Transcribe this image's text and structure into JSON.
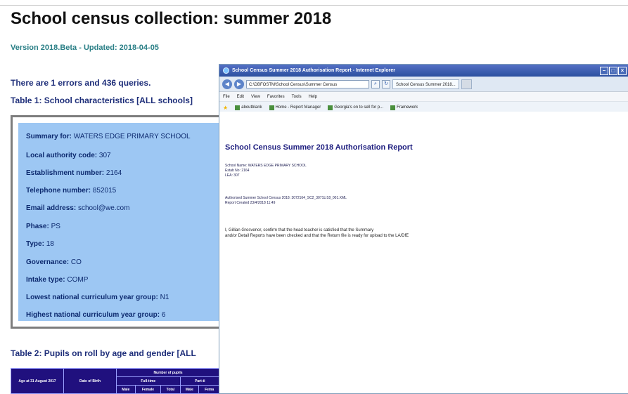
{
  "page": {
    "title": "School census collection: summer 2018",
    "version": "Version 2018.Beta - Updated: 2018-04-05",
    "errors_text": "There are 1 errors and 436 queries.",
    "table1_heading": "Table 1: School characteristics [ALL schools]",
    "table2_heading": "Table 2: Pupils on roll by age and gender [ALL"
  },
  "summary": [
    {
      "label": "Summary for:",
      "value": "WATERS EDGE PRIMARY SCHOOL"
    },
    {
      "label": "Local authority code:",
      "value": "307"
    },
    {
      "label": "Establishment number:",
      "value": "2164"
    },
    {
      "label": "Telephone number:",
      "value": "852015"
    },
    {
      "label": "Email address:",
      "value": "school@we.com"
    },
    {
      "label": "Phase:",
      "value": "PS"
    },
    {
      "label": "Type:",
      "value": "18"
    },
    {
      "label": "Governance:",
      "value": "CO"
    },
    {
      "label": "Intake type:",
      "value": "COMP"
    },
    {
      "label": "Lowest national curriculum year group:",
      "value": "N1"
    },
    {
      "label": "Highest national curriculum year group:",
      "value": "6"
    }
  ],
  "table2": {
    "headers": [
      "Age at 31 August 2017",
      "Date of Birth",
      "Number of pupils"
    ],
    "subheaders": [
      "Full-time",
      "Part-ti"
    ],
    "cols": [
      "Male",
      "Female",
      "Total",
      "Male",
      "Fema"
    ]
  },
  "browser": {
    "title": "School Census Summer 2018 Authorisation Report - Internet Explorer",
    "address": "C:\\DBFOSTM\\School Census\\Summer Census",
    "tab": "School Census Summer 2018...",
    "menu": [
      "File",
      "Edit",
      "View",
      "Favorites",
      "Tools",
      "Help"
    ],
    "favorites": [
      "aboutblank",
      "Home - Report Manager",
      "Georgia's on to sell for p...",
      "Framework"
    ],
    "report_title": "School Census Summer 2018 Authorisation Report",
    "school_name": "School Name: WATERS EDGE PRIMARY SCHOOL",
    "estab": "Estab No: 2164",
    "lea": "LEA: 307",
    "authorised": "Authorised Summer School Census 2018: 3072164_SC2_3071LI18_001.XML",
    "report_created": "Report Created 23/4/2018 11:49",
    "confirm_line1": "I, Gillian Grosvenor, confirm that the head teacher is satisfied that the Summary",
    "confirm_line2": "and/or Detail Reports have been checked and that the Return file is ready for upload to the LA/DfE"
  }
}
